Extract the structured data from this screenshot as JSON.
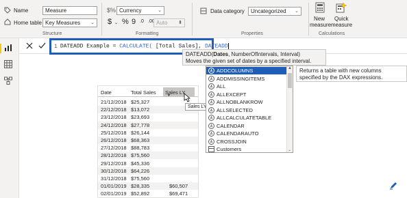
{
  "ribbon": {
    "name_label": "Name",
    "name_value": "Measure",
    "home_table_label": "Home table",
    "home_table_value": "Key Measures",
    "format_value": "Currency",
    "currency_symbol": "$",
    "percent_symbol": "%",
    "comma_symbol": "9",
    "decimal_dec": ".0",
    "decimal_inc": ".00",
    "auto_value": "Auto",
    "data_category_label": "Data category",
    "data_category_value": "Uncategorized",
    "new_measure_label_1": "New",
    "new_measure_label_2": "measure",
    "quick_measure_label_1": "Quick",
    "quick_measure_label_2": "measure",
    "group_structure": "Structure",
    "group_formatting": "Formatting",
    "group_properties": "Properties",
    "group_calculations": "Calculations"
  },
  "formula": {
    "line_number": "1",
    "text_prefix": "DATEADD Example = ",
    "fn_calculate": "CALCULATE(",
    "args": " [Total Sales], ",
    "fn_dateadd": "DATEADD"
  },
  "signature": {
    "prefix": "DATEADD(",
    "bold_param": "Dates",
    "rest": ", NumberOfIntervals, Interval)",
    "description": "Moves the given set of dates by a specified interval."
  },
  "intellisense": {
    "items": [
      "ADDCOLUMNS",
      "ADDMISSINGITEMS",
      "ALL",
      "ALLEXCEPT",
      "ALLNOBLANKROW",
      "ALLSELECTED",
      "ALLCALCULATETABLE",
      "CALENDAR",
      "CALENDARAUTO",
      "CROSSJOIN",
      "Customers"
    ],
    "selected_index": 0,
    "description": "Returns a table with new columns specified by the DAX expressions."
  },
  "table": {
    "headers": [
      "Date",
      "Total Sales",
      "Sales LY"
    ],
    "rows": [
      [
        "21/12/2018",
        "$25,327",
        ""
      ],
      [
        "22/12/2018",
        "$13,072",
        ""
      ],
      [
        "23/12/2018",
        "$23,693",
        ""
      ],
      [
        "24/12/2018",
        "$27,778",
        ""
      ],
      [
        "25/12/2018",
        "$26,144",
        ""
      ],
      [
        "26/12/2018",
        "$68,363",
        ""
      ],
      [
        "27/12/2018",
        "$88,783",
        ""
      ],
      [
        "28/12/2018",
        "$75,560",
        ""
      ],
      [
        "29/12/2018",
        "$45,336",
        ""
      ],
      [
        "30/12/2018",
        "$64,226",
        ""
      ],
      [
        "31/12/2018",
        "$75,560",
        ""
      ],
      [
        "01/01/2019",
        "$28,335",
        "$60,507"
      ],
      [
        "02/01/2019",
        "$52,892",
        "$69,471"
      ]
    ],
    "column_tooltip": "Sales LY"
  },
  "colors": {
    "accent": "#1f5eb8",
    "ribbon_bg": "#f3f2f1",
    "active_nav": "#f2c811"
  }
}
